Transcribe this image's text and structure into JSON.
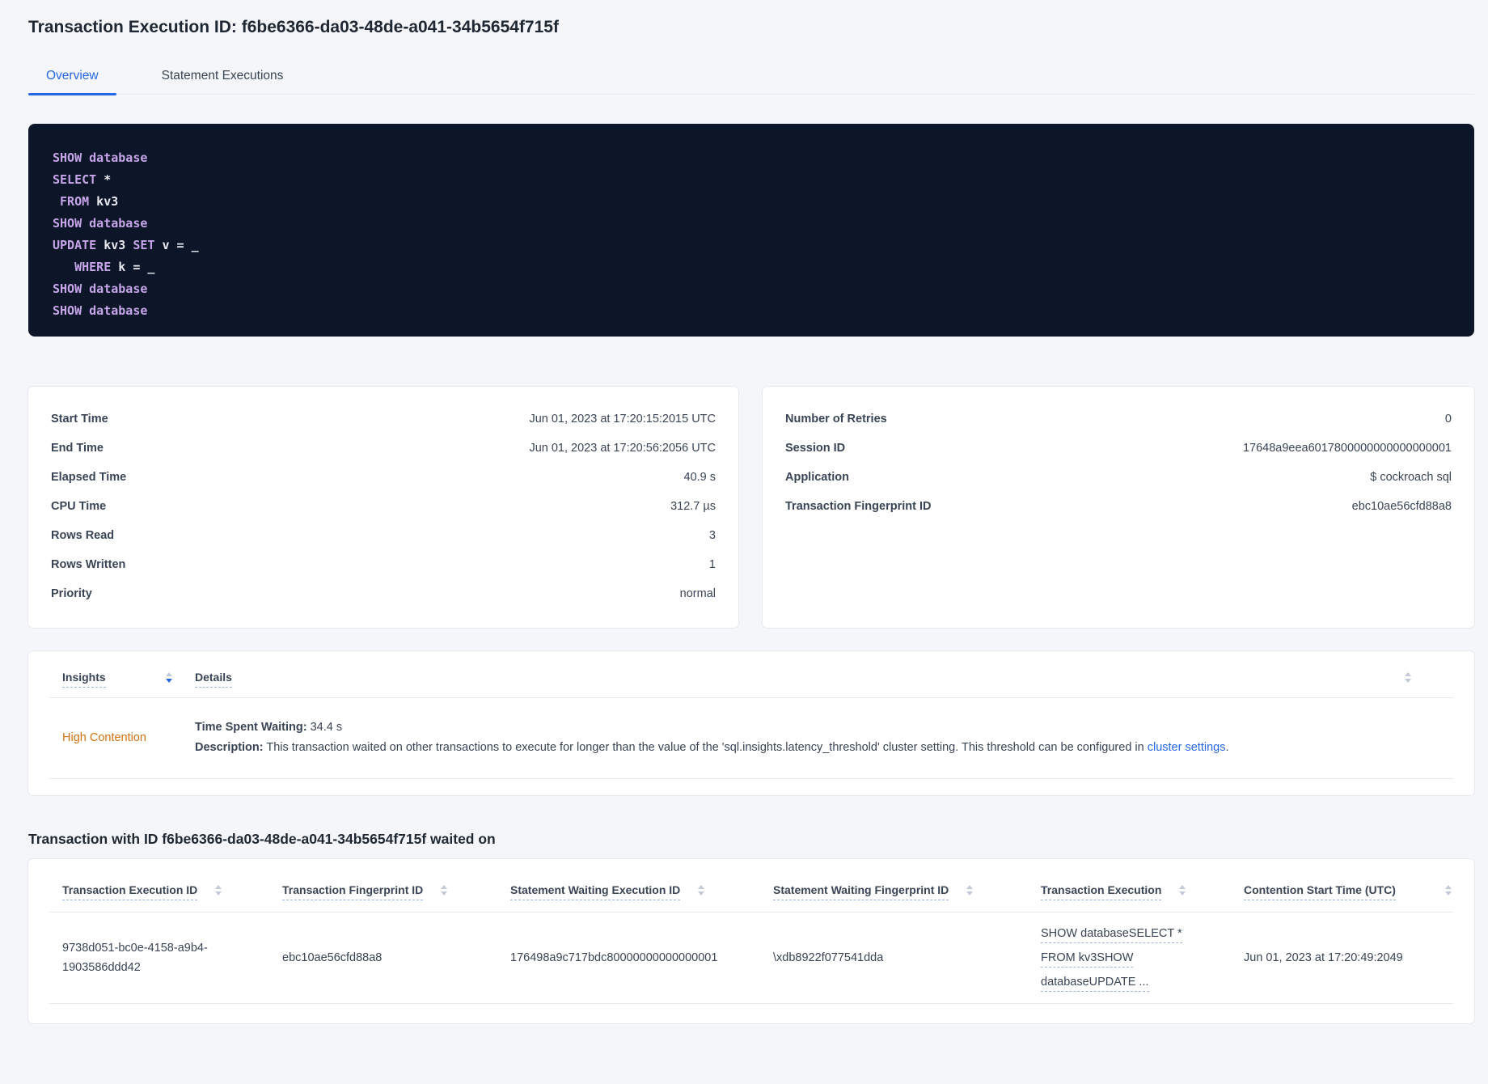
{
  "colors": {
    "accent_blue": "#2767e6",
    "warning_orange": "#cf7410",
    "code_keyword": "#c6a5e9",
    "code_text": "#e9e9f2",
    "code_bg": "#0c1628"
  },
  "page": {
    "title": "Transaction Execution ID: f6be6366-da03-48de-a041-34b5654f715f"
  },
  "tabs": [
    {
      "label": "Overview"
    },
    {
      "label": "Statement Executions"
    }
  ],
  "sql_box": {
    "lines": [
      [
        [
          "SHOW database",
          1
        ]
      ],
      [
        [
          "SELECT",
          1
        ],
        [
          " *",
          0
        ]
      ],
      [
        [
          " FROM",
          1
        ],
        [
          " kv3",
          0
        ]
      ],
      [
        [
          "SHOW database",
          1
        ]
      ],
      [
        [
          "UPDATE",
          1
        ],
        [
          " kv3 ",
          0
        ],
        [
          "SET",
          1
        ],
        [
          " v = _",
          0
        ]
      ],
      [
        [
          "   WHERE",
          1
        ],
        [
          " k = _",
          0
        ]
      ],
      [
        [
          "SHOW database",
          1
        ]
      ],
      [
        [
          "SHOW database",
          1
        ]
      ]
    ]
  },
  "summary_left": {
    "rows": [
      {
        "label": "Start Time",
        "value": "Jun 01, 2023 at 17:20:15:2015 UTC"
      },
      {
        "label": "End Time",
        "value": "Jun 01, 2023 at 17:20:56:2056 UTC"
      },
      {
        "label": "Elapsed Time",
        "value": "40.9 s"
      },
      {
        "label": "CPU Time",
        "value": "312.7 µs"
      },
      {
        "label": "Rows Read",
        "value": "3"
      },
      {
        "label": "Rows Written",
        "value": "1"
      },
      {
        "label": "Priority",
        "value": "normal"
      }
    ]
  },
  "summary_right": {
    "rows": [
      {
        "label": "Number of Retries",
        "value": "0"
      },
      {
        "label": "Session ID",
        "value": "17648a9eea6017800000000000000001"
      },
      {
        "label": "Application",
        "value": "$ cockroach sql"
      },
      {
        "label": "Transaction Fingerprint ID",
        "value": "ebc10ae56cfd88a8"
      }
    ]
  },
  "insights": {
    "columns": [
      {
        "label": "Insights"
      },
      {
        "label": "Details"
      }
    ],
    "row": {
      "insight": "High Contention",
      "waiting_label": "Time Spent Waiting:",
      "waiting_value": " 34.4 s",
      "description_label": "Description:",
      "description_text": " This transaction waited on other transactions to execute for longer than the value of the 'sql.insights.latency_threshold' cluster setting. This threshold can be configured in ",
      "description_link": "cluster settings",
      "description_suffix": "."
    }
  },
  "waited_on": {
    "heading": "Transaction with ID f6be6366-da03-48de-a041-34b5654f715f waited on",
    "columns": [
      "Transaction Execution ID",
      "Transaction Fingerprint ID",
      "Statement Waiting Execution ID",
      "Statement Waiting Fingerprint ID",
      "Transaction Execution",
      "Contention Start Time (UTC)"
    ],
    "row": {
      "transaction_execution_id": "9738d051-bc0e-4158-a9b4-1903586ddd42",
      "transaction_fingerprint_id": "ebc10ae56cfd88a8",
      "statement_waiting_execution_id": "176498a9c717bdc80000000000000001",
      "statement_waiting_fingerprint_id": "\\xdb8922f077541dda",
      "transaction_execution": "SHOW databaseSELECT * FROM kv3SHOW databaseUPDATE ...",
      "contention_start_time": "Jun 01, 2023 at 17:20:49:2049"
    }
  }
}
